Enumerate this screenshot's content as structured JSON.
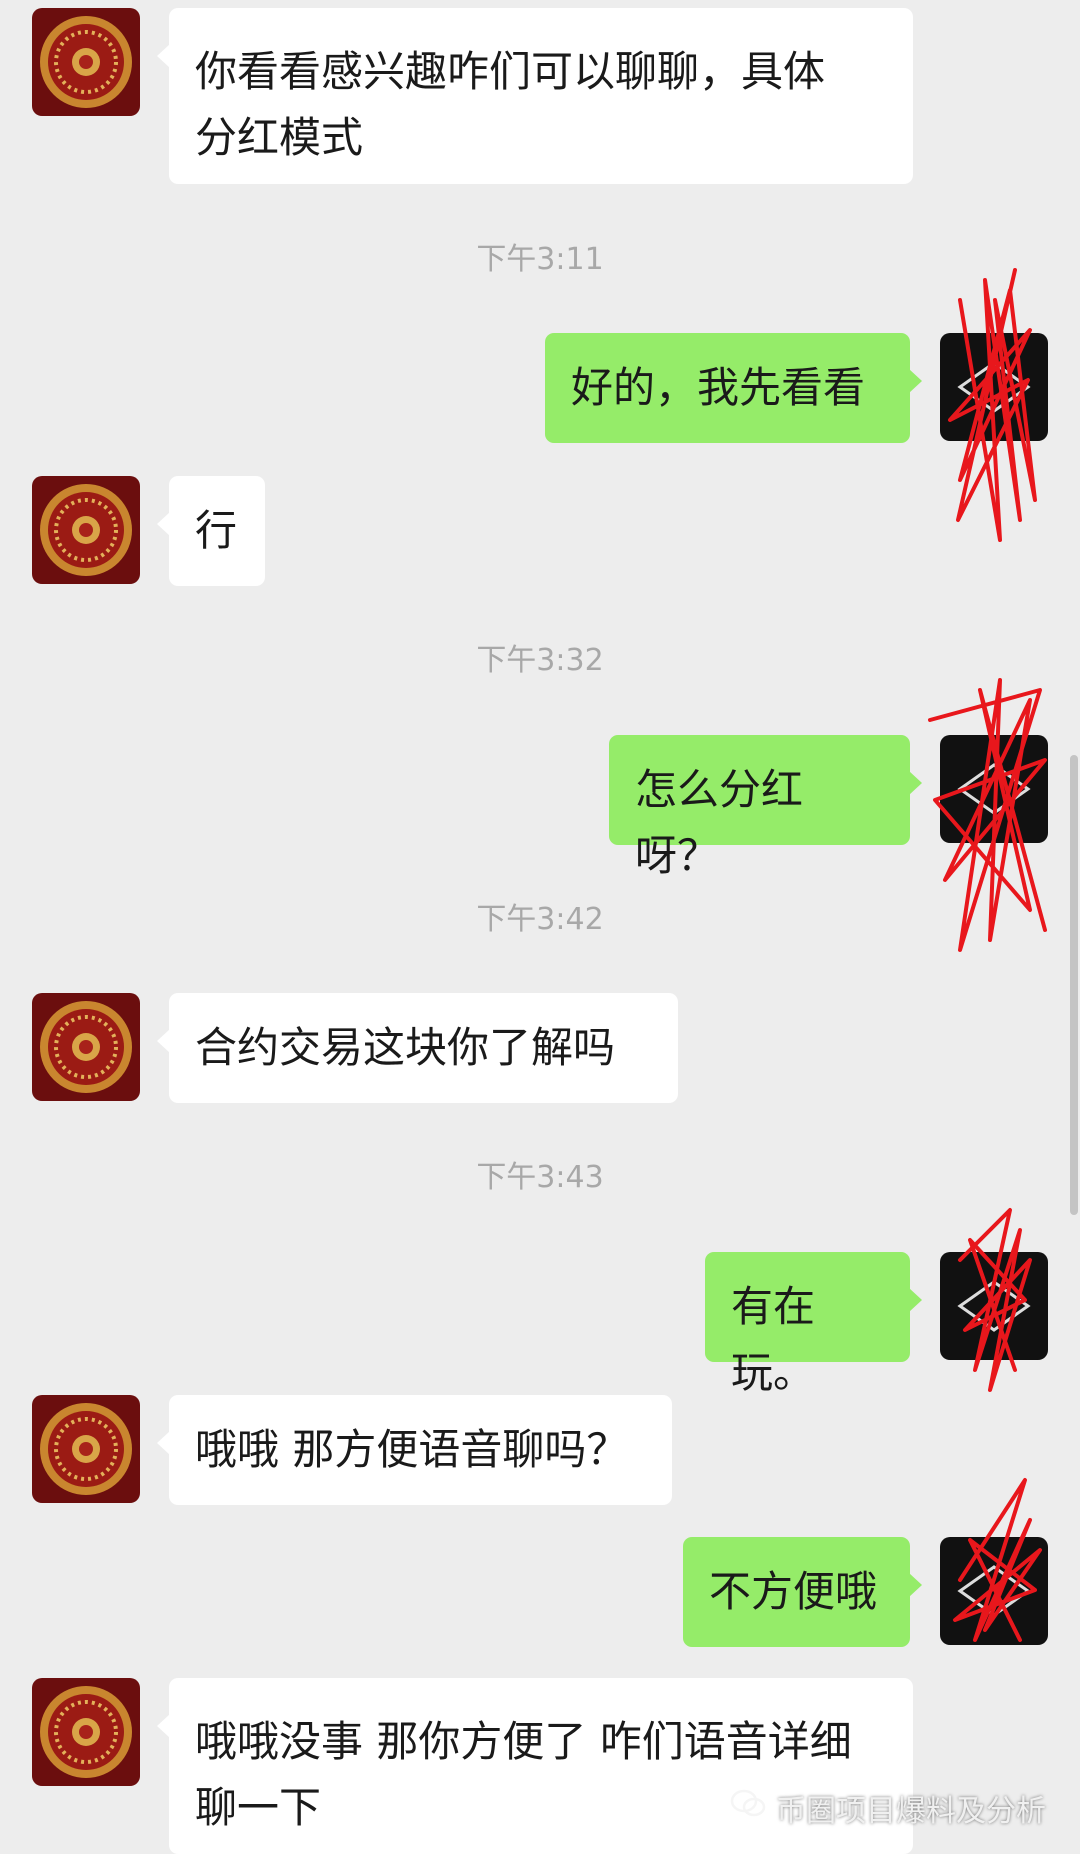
{
  "messages": [
    {
      "id": "m1",
      "dir": "in",
      "text": "你看看感兴趣咋们可以聊聊，具体\n分红模式"
    },
    {
      "id": "t1",
      "type": "timestamp",
      "text": "下午3:11"
    },
    {
      "id": "m2",
      "dir": "out",
      "text": "好的，我先看看"
    },
    {
      "id": "m3",
      "dir": "in",
      "text": "行"
    },
    {
      "id": "t2",
      "type": "timestamp",
      "text": "下午3:32"
    },
    {
      "id": "m4",
      "dir": "out",
      "text": "怎么分红呀？"
    },
    {
      "id": "t3",
      "type": "timestamp",
      "text": "下午3:42"
    },
    {
      "id": "m5",
      "dir": "in",
      "text": "合约交易这块你了解吗"
    },
    {
      "id": "t4",
      "type": "timestamp",
      "text": "下午3:43"
    },
    {
      "id": "m6",
      "dir": "out",
      "text": "有在玩。"
    },
    {
      "id": "m7",
      "dir": "in",
      "text": "哦哦 那方便语音聊吗？"
    },
    {
      "id": "m8",
      "dir": "out",
      "text": "不方便哦"
    },
    {
      "id": "m9",
      "dir": "in",
      "text": "哦哦没事 那你方便了 咋们语音详细\n聊一下"
    }
  ],
  "watermark": {
    "text": "币圈项目爆料及分析",
    "icon": "wechat-icon"
  },
  "colors": {
    "background": "#ededed",
    "incoming_bubble": "#ffffff",
    "outgoing_bubble": "#95ec69",
    "timestamp": "#a8a8a8",
    "scribble": "#e8171c"
  }
}
